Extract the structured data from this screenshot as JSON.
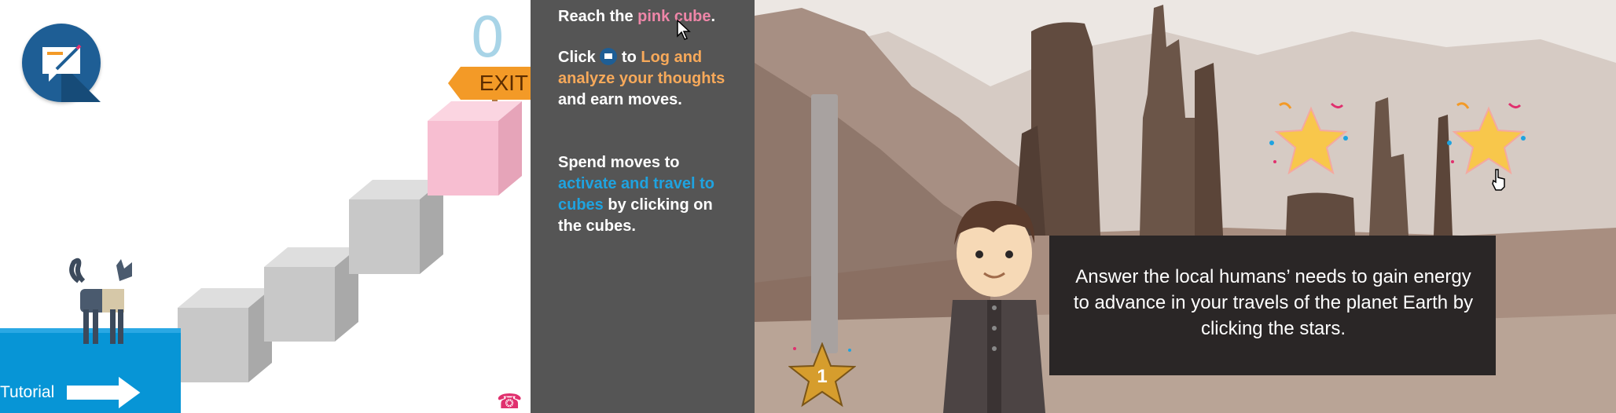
{
  "puzzle": {
    "moves_count": "0",
    "exit_label": "EXIT",
    "tutorial_label": "Tutorial"
  },
  "instructions": {
    "p1": {
      "a": "Reach the ",
      "b": "pink cube",
      "c": "."
    },
    "p2": {
      "a": "Click ",
      "b": " to ",
      "c": "Log and analyze your thoughts",
      "d": " and earn moves."
    },
    "p3": {
      "a": "Spend moves to ",
      "b": "activate and travel to cubes",
      "c": " by clicking on the cubes."
    }
  },
  "stars_game": {
    "level": "1",
    "message": "Answer the local humans’ needs to gain energy to advance in your travels of the planet Earth by clicking the stars."
  },
  "colors": {
    "accent_blue": "#0795d6",
    "instruction_bg": "#555555",
    "pink_cube": "#f7bed1",
    "exit_sign": "#f39a27",
    "star": "#f8c74b"
  }
}
